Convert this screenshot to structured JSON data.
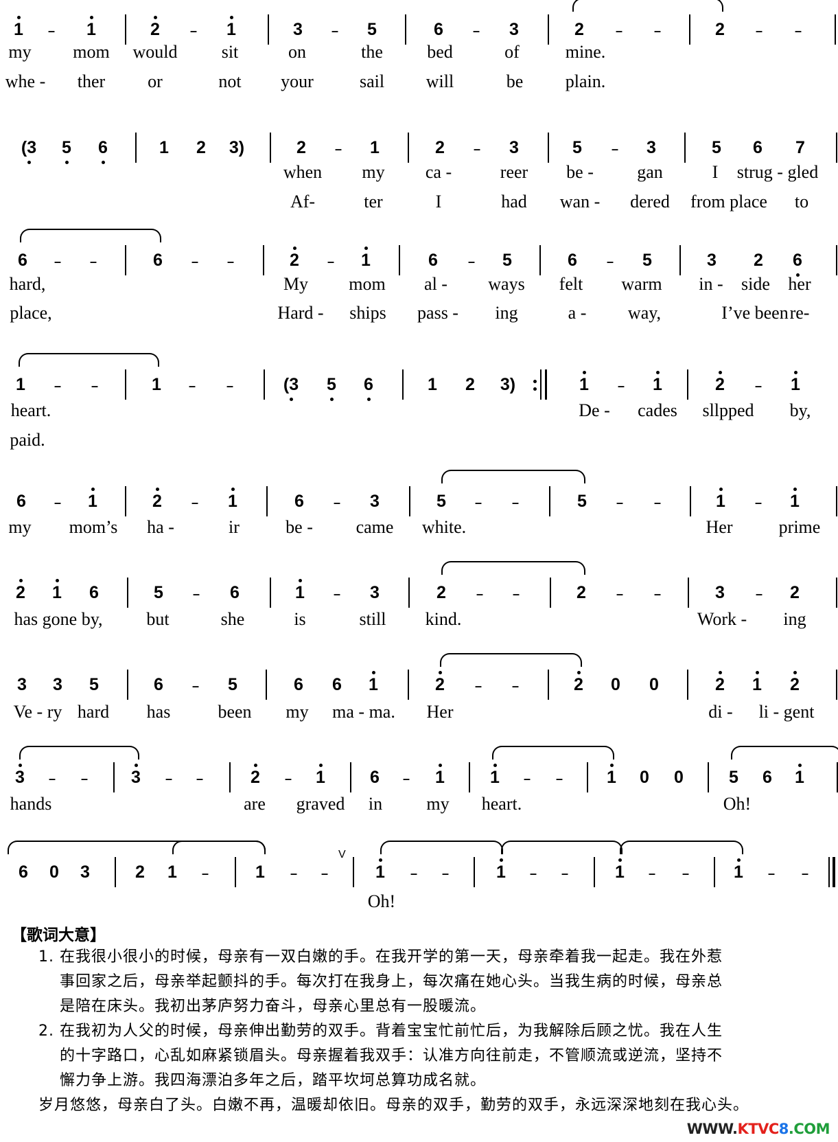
{
  "score": {
    "systems": [
      {
        "notes": [
          "1̇",
          "-",
          "1̇",
          "|",
          "2̇",
          "-",
          "1̇",
          "|",
          "3",
          "-",
          "5",
          "|",
          "6",
          "-",
          "3",
          "|",
          "2",
          "-",
          "-",
          "|",
          "2",
          "-",
          "-",
          "|"
        ],
        "lyrics": [
          [
            "my",
            "mom",
            "would",
            "sit",
            "on",
            "the",
            "bed",
            "of",
            "mine."
          ],
          [
            "whe -",
            "ther",
            "or",
            "not",
            "your",
            "sail",
            "will",
            "be",
            "plain."
          ]
        ]
      },
      {
        "notes": [
          "(3̣",
          "5̣",
          "6̣",
          "|",
          "1",
          "2",
          "3)",
          "|",
          "2",
          "-",
          "1",
          "|",
          "2",
          "-",
          "3",
          "|",
          "5",
          "-",
          "3",
          "|",
          "5",
          "6",
          "7",
          "|"
        ],
        "lyrics": [
          [
            "when",
            "my",
            "ca -",
            "reer",
            "be -",
            "gan",
            "I",
            "strug - gled"
          ],
          [
            "Af-",
            "ter",
            "I",
            "had",
            "wan -",
            "dered",
            "from place",
            "to"
          ]
        ]
      },
      {
        "notes": [
          "6",
          "-",
          "-",
          "|",
          "6",
          "-",
          "-",
          "|",
          "2̇",
          "-",
          "1̇",
          "|",
          "6",
          "-",
          "5",
          "|",
          "6",
          "-",
          "5",
          "|",
          "3",
          "2",
          "6̣",
          "|"
        ],
        "lyrics": [
          [
            "hard,",
            "My",
            "mom",
            "al -",
            "ways",
            "felt",
            "warm",
            "in -",
            "side",
            "her"
          ],
          [
            "place,",
            "Hard -",
            "ships",
            "pass -",
            "ing",
            "a -",
            "way,",
            "I’ve been",
            "re-"
          ]
        ]
      },
      {
        "notes": [
          "1",
          "-",
          "-",
          "|",
          "1",
          "-",
          "-",
          "|",
          "(3̣",
          "5̣",
          "6̣",
          "|",
          "1",
          "2",
          "3)",
          ":‖",
          "1̇",
          "-",
          "1̇",
          "|",
          "2̇",
          "-",
          "1̇"
        ],
        "lyrics": [
          [
            "heart.",
            "De -",
            "cades",
            "sllpped",
            "by,"
          ],
          [
            "paid."
          ]
        ]
      },
      {
        "notes": [
          "6",
          "-",
          "1̇",
          "|",
          "2̇",
          "-",
          "1̇",
          "|",
          "6",
          "-",
          "3",
          "|",
          "5",
          "-",
          "-",
          "|",
          "5",
          "-",
          "-",
          "|",
          "1̇",
          "-",
          "1̇",
          "|"
        ],
        "lyrics": [
          [
            "my",
            "mom’s",
            "ha -",
            "ir",
            "be -",
            "came",
            "white.",
            "Her",
            "prime"
          ]
        ]
      },
      {
        "notes": [
          "2̇",
          "1̇",
          "6",
          "|",
          "5",
          "-",
          "6",
          "|",
          "1̇",
          "-",
          "3",
          "|",
          "2",
          "-",
          "-",
          "|",
          "2",
          "-",
          "-",
          "|",
          "3",
          "-",
          "2",
          "|"
        ],
        "lyrics": [
          [
            "has gone by,",
            "but",
            "she",
            "is",
            "still",
            "kind.",
            "Work -",
            "ing"
          ]
        ]
      },
      {
        "notes": [
          "3",
          "3",
          "5",
          "|",
          "6",
          "-",
          "5",
          "|",
          "6",
          "6",
          "1̇",
          "|",
          "2̇",
          "-",
          "-",
          "|",
          "2̇",
          "0",
          "0",
          "|",
          "2̇",
          "1̇",
          "2̇",
          "|"
        ],
        "lyrics": [
          [
            "Ve - ry",
            "hard",
            "has",
            "been",
            "my",
            "ma - ma.",
            "Her",
            "di -",
            "li - gent"
          ]
        ]
      },
      {
        "notes": [
          "3̇",
          "-",
          "-",
          "|",
          "3̇",
          "-",
          "-",
          "|",
          "2̇",
          "-",
          "1̇",
          "|",
          "6",
          "-",
          "1̇",
          "|",
          "1̇",
          "-",
          "-",
          "|",
          "1̇",
          "0",
          "0",
          "|",
          "5",
          "6",
          "1̇"
        ],
        "lyrics": [
          [
            "hands",
            "are",
            "graved",
            "in",
            "my",
            "heart.",
            "Oh!"
          ]
        ]
      },
      {
        "notes": [
          "6",
          "0",
          "3",
          "|",
          "2",
          "1",
          "-",
          "|",
          "1",
          "-",
          "-",
          "V",
          "|",
          "1̇",
          "-",
          "-",
          "|",
          "1̇",
          "-",
          "-",
          "|",
          "1̇",
          "-",
          "-",
          "|",
          "1̇",
          "-",
          "-",
          "‖"
        ],
        "lyrics": [
          [
            "Oh!"
          ]
        ]
      }
    ]
  },
  "meaning": {
    "title": "【歌词大意】",
    "paragraphs": [
      "1. 在我很小很小的时候，母亲有一双白嫩的手。在我开学的第一天，母亲牵着我一起走。我在外惹",
      "事回家之后，母亲举起颤抖的手。每次打在我身上，每次痛在她心头。当我生病的时候，母亲总",
      "是陪在床头。我初出茅庐努力奋斗，母亲心里总有一股暖流。",
      "2. 在我初为人父的时候，母亲伸出勤劳的双手。背着宝宝忙前忙后，为我解除后顾之忧。我在人生",
      "的十字路口，心乱如麻紧锁眉头。母亲握着我双手：认准方向往前走，不管顺流或逆流，坚持不",
      "懈力争上游。我四海漂泊多年之后，踏平坎坷总算功成名就。",
      "岁月悠悠，母亲白了头。白嫩不再，温暖却依旧。母亲的双手，勤劳的双手，永远深深地刻在我心头。"
    ]
  },
  "watermark": {
    "part1": "WWW.",
    "part2": "KTVC",
    "part3": "8",
    "part4": ".COM"
  }
}
